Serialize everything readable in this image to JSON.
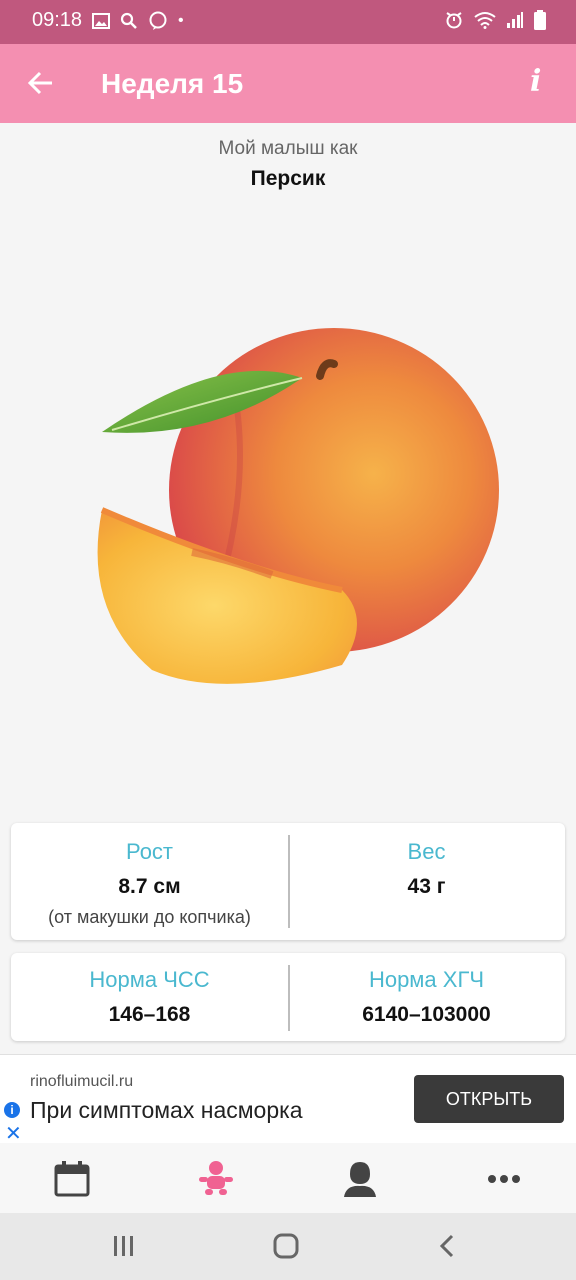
{
  "status_bar": {
    "time": "09:18"
  },
  "app_bar": {
    "title": "Неделя 15",
    "info": "i"
  },
  "hero": {
    "subtitle": "Мой малыш как",
    "fruit": "Персик"
  },
  "stats": {
    "height_label": "Рост",
    "height_value": "8.7 см",
    "height_note": "(от макушки до копчика)",
    "weight_label": "Вес",
    "weight_value": "43 г",
    "hr_label": "Норма ЧСС",
    "hr_value": "146–168",
    "hcg_label": "Норма ХГЧ",
    "hcg_value": "6140–103000"
  },
  "ad": {
    "domain": "rinofluimucil.ru",
    "text": "При симптомах насморка",
    "button": "ОТКРЫТЬ"
  },
  "bottom_nav": [
    "calendar-icon",
    "baby-icon",
    "person-icon",
    "more-icon"
  ],
  "colors": {
    "status_bar": "#c0587e",
    "app_bar": "#f48fb1",
    "accent_label": "#4ab8cf",
    "active_nav": "#f06292"
  }
}
